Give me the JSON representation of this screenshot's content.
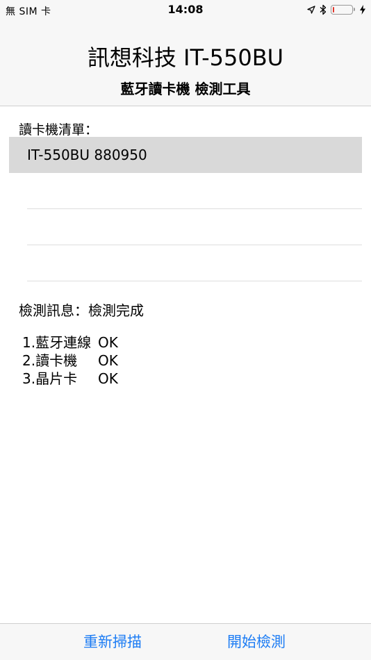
{
  "status_bar": {
    "carrier": "無 SIM 卡",
    "time": "14:08",
    "battery_level": 0.08,
    "icons": [
      "location-arrow-icon",
      "bluetooth-icon",
      "battery-icon",
      "charging-bolt-icon"
    ]
  },
  "header": {
    "title": "訊想科技 IT-550BU",
    "subtitle": "藍牙讀卡機 檢測工具"
  },
  "reader_list": {
    "label": "讀卡機清單：",
    "items": [
      {
        "label": "IT-550BU 880950",
        "selected": true
      },
      {
        "label": "",
        "selected": false
      },
      {
        "label": "",
        "selected": false
      },
      {
        "label": "",
        "selected": false
      }
    ]
  },
  "message": {
    "text": "檢測訊息：檢測完成"
  },
  "results": [
    {
      "label": "1.藍牙連線",
      "status": "OK"
    },
    {
      "label": "2.讀卡機",
      "status": "OK"
    },
    {
      "label": "3.晶片卡",
      "status": "OK"
    }
  ],
  "toolbar": {
    "rescan_label": "重新掃描",
    "start_label": "開始檢測",
    "accent_color": "#1c7cf4"
  }
}
